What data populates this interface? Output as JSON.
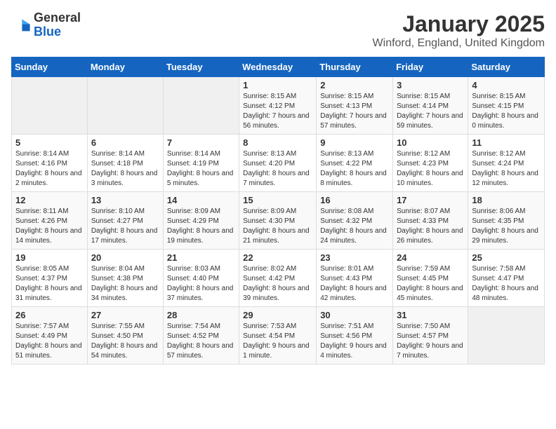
{
  "logo": {
    "general": "General",
    "blue": "Blue"
  },
  "title": "January 2025",
  "subtitle": "Winford, England, United Kingdom",
  "days_of_week": [
    "Sunday",
    "Monday",
    "Tuesday",
    "Wednesday",
    "Thursday",
    "Friday",
    "Saturday"
  ],
  "weeks": [
    [
      {
        "day": "",
        "sunrise": "",
        "sunset": "",
        "daylight": ""
      },
      {
        "day": "",
        "sunrise": "",
        "sunset": "",
        "daylight": ""
      },
      {
        "day": "",
        "sunrise": "",
        "sunset": "",
        "daylight": ""
      },
      {
        "day": "1",
        "sunrise": "Sunrise: 8:15 AM",
        "sunset": "Sunset: 4:12 PM",
        "daylight": "Daylight: 7 hours and 56 minutes."
      },
      {
        "day": "2",
        "sunrise": "Sunrise: 8:15 AM",
        "sunset": "Sunset: 4:13 PM",
        "daylight": "Daylight: 7 hours and 57 minutes."
      },
      {
        "day": "3",
        "sunrise": "Sunrise: 8:15 AM",
        "sunset": "Sunset: 4:14 PM",
        "daylight": "Daylight: 7 hours and 59 minutes."
      },
      {
        "day": "4",
        "sunrise": "Sunrise: 8:15 AM",
        "sunset": "Sunset: 4:15 PM",
        "daylight": "Daylight: 8 hours and 0 minutes."
      }
    ],
    [
      {
        "day": "5",
        "sunrise": "Sunrise: 8:14 AM",
        "sunset": "Sunset: 4:16 PM",
        "daylight": "Daylight: 8 hours and 2 minutes."
      },
      {
        "day": "6",
        "sunrise": "Sunrise: 8:14 AM",
        "sunset": "Sunset: 4:18 PM",
        "daylight": "Daylight: 8 hours and 3 minutes."
      },
      {
        "day": "7",
        "sunrise": "Sunrise: 8:14 AM",
        "sunset": "Sunset: 4:19 PM",
        "daylight": "Daylight: 8 hours and 5 minutes."
      },
      {
        "day": "8",
        "sunrise": "Sunrise: 8:13 AM",
        "sunset": "Sunset: 4:20 PM",
        "daylight": "Daylight: 8 hours and 7 minutes."
      },
      {
        "day": "9",
        "sunrise": "Sunrise: 8:13 AM",
        "sunset": "Sunset: 4:22 PM",
        "daylight": "Daylight: 8 hours and 8 minutes."
      },
      {
        "day": "10",
        "sunrise": "Sunrise: 8:12 AM",
        "sunset": "Sunset: 4:23 PM",
        "daylight": "Daylight: 8 hours and 10 minutes."
      },
      {
        "day": "11",
        "sunrise": "Sunrise: 8:12 AM",
        "sunset": "Sunset: 4:24 PM",
        "daylight": "Daylight: 8 hours and 12 minutes."
      }
    ],
    [
      {
        "day": "12",
        "sunrise": "Sunrise: 8:11 AM",
        "sunset": "Sunset: 4:26 PM",
        "daylight": "Daylight: 8 hours and 14 minutes."
      },
      {
        "day": "13",
        "sunrise": "Sunrise: 8:10 AM",
        "sunset": "Sunset: 4:27 PM",
        "daylight": "Daylight: 8 hours and 17 minutes."
      },
      {
        "day": "14",
        "sunrise": "Sunrise: 8:09 AM",
        "sunset": "Sunset: 4:29 PM",
        "daylight": "Daylight: 8 hours and 19 minutes."
      },
      {
        "day": "15",
        "sunrise": "Sunrise: 8:09 AM",
        "sunset": "Sunset: 4:30 PM",
        "daylight": "Daylight: 8 hours and 21 minutes."
      },
      {
        "day": "16",
        "sunrise": "Sunrise: 8:08 AM",
        "sunset": "Sunset: 4:32 PM",
        "daylight": "Daylight: 8 hours and 24 minutes."
      },
      {
        "day": "17",
        "sunrise": "Sunrise: 8:07 AM",
        "sunset": "Sunset: 4:33 PM",
        "daylight": "Daylight: 8 hours and 26 minutes."
      },
      {
        "day": "18",
        "sunrise": "Sunrise: 8:06 AM",
        "sunset": "Sunset: 4:35 PM",
        "daylight": "Daylight: 8 hours and 29 minutes."
      }
    ],
    [
      {
        "day": "19",
        "sunrise": "Sunrise: 8:05 AM",
        "sunset": "Sunset: 4:37 PM",
        "daylight": "Daylight: 8 hours and 31 minutes."
      },
      {
        "day": "20",
        "sunrise": "Sunrise: 8:04 AM",
        "sunset": "Sunset: 4:38 PM",
        "daylight": "Daylight: 8 hours and 34 minutes."
      },
      {
        "day": "21",
        "sunrise": "Sunrise: 8:03 AM",
        "sunset": "Sunset: 4:40 PM",
        "daylight": "Daylight: 8 hours and 37 minutes."
      },
      {
        "day": "22",
        "sunrise": "Sunrise: 8:02 AM",
        "sunset": "Sunset: 4:42 PM",
        "daylight": "Daylight: 8 hours and 39 minutes."
      },
      {
        "day": "23",
        "sunrise": "Sunrise: 8:01 AM",
        "sunset": "Sunset: 4:43 PM",
        "daylight": "Daylight: 8 hours and 42 minutes."
      },
      {
        "day": "24",
        "sunrise": "Sunrise: 7:59 AM",
        "sunset": "Sunset: 4:45 PM",
        "daylight": "Daylight: 8 hours and 45 minutes."
      },
      {
        "day": "25",
        "sunrise": "Sunrise: 7:58 AM",
        "sunset": "Sunset: 4:47 PM",
        "daylight": "Daylight: 8 hours and 48 minutes."
      }
    ],
    [
      {
        "day": "26",
        "sunrise": "Sunrise: 7:57 AM",
        "sunset": "Sunset: 4:49 PM",
        "daylight": "Daylight: 8 hours and 51 minutes."
      },
      {
        "day": "27",
        "sunrise": "Sunrise: 7:55 AM",
        "sunset": "Sunset: 4:50 PM",
        "daylight": "Daylight: 8 hours and 54 minutes."
      },
      {
        "day": "28",
        "sunrise": "Sunrise: 7:54 AM",
        "sunset": "Sunset: 4:52 PM",
        "daylight": "Daylight: 8 hours and 57 minutes."
      },
      {
        "day": "29",
        "sunrise": "Sunrise: 7:53 AM",
        "sunset": "Sunset: 4:54 PM",
        "daylight": "Daylight: 9 hours and 1 minute."
      },
      {
        "day": "30",
        "sunrise": "Sunrise: 7:51 AM",
        "sunset": "Sunset: 4:56 PM",
        "daylight": "Daylight: 9 hours and 4 minutes."
      },
      {
        "day": "31",
        "sunrise": "Sunrise: 7:50 AM",
        "sunset": "Sunset: 4:57 PM",
        "daylight": "Daylight: 9 hours and 7 minutes."
      },
      {
        "day": "",
        "sunrise": "",
        "sunset": "",
        "daylight": ""
      }
    ]
  ]
}
